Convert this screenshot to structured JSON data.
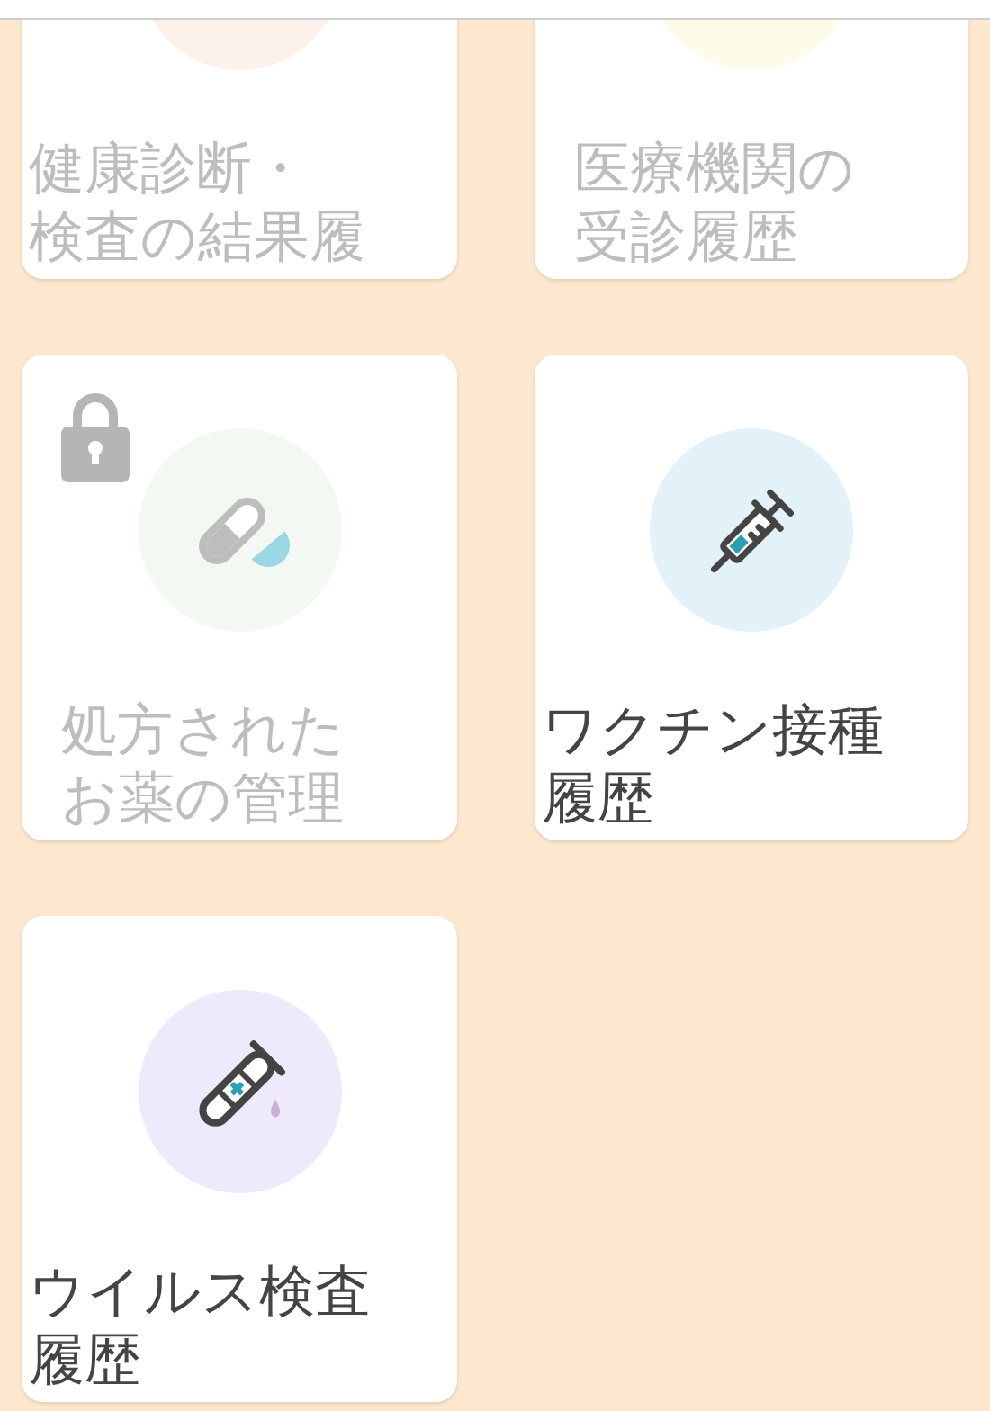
{
  "cards": [
    {
      "title_lines": [
        "健康診断・",
        "検査の結果履"
      ],
      "disabled": true,
      "locked": false,
      "color": "#fdf1ec"
    },
    {
      "title_lines": [
        "医療機関の",
        "受診履歴"
      ],
      "disabled": true,
      "locked": false,
      "color": "#fefbe9"
    },
    {
      "title_lines": [
        "処方された",
        "お薬の管理"
      ],
      "disabled": true,
      "locked": true,
      "color": "#f3f9f2",
      "kind": "pill"
    },
    {
      "title_lines": [
        "ワクチン接種",
        "履歴"
      ],
      "disabled": false,
      "locked": false,
      "color": "#e3f2f8",
      "kind": "syringe"
    },
    {
      "title_lines": [
        "ウイルス検査",
        "履歴"
      ],
      "disabled": false,
      "locked": false,
      "color": "#eeeafc",
      "kind": "test-tube"
    }
  ]
}
